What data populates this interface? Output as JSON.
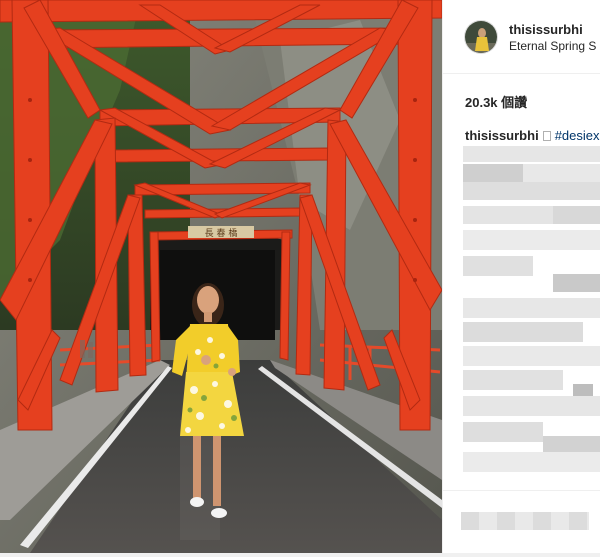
{
  "post": {
    "username": "thisissurbhi",
    "location": "Eternal Spring S",
    "likes": "20.3k 個讚",
    "caption_user": "thisissurbhi",
    "caption_tag": "#desiex"
  },
  "photo": {
    "bridge_sign": "長 春 橋"
  },
  "colors": {
    "bridge_red": "#e5401f",
    "dress_yellow": "#f3cf2e",
    "hashtag_blue": "#003569"
  }
}
